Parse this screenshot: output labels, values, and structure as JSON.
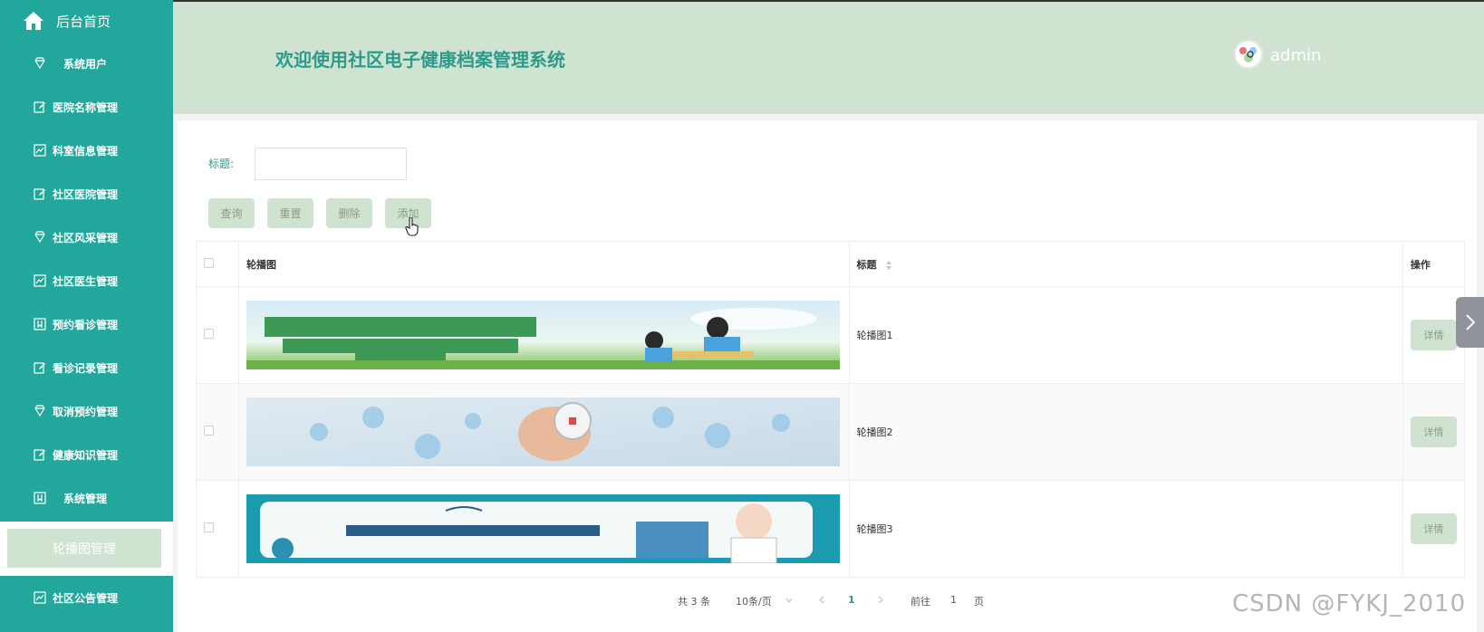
{
  "sidebar": {
    "home": {
      "label": "后台首页",
      "icon": "home-icon"
    },
    "items": [
      {
        "label": "系统用户",
        "icon": "diamond-icon"
      },
      {
        "label": "医院名称管理",
        "icon": "edit-icon"
      },
      {
        "label": "科室信息管理",
        "icon": "chart-icon"
      },
      {
        "label": "社区医院管理",
        "icon": "edit-icon"
      },
      {
        "label": "社区风采管理",
        "icon": "diamond-icon"
      },
      {
        "label": "社区医生管理",
        "icon": "chart-icon"
      },
      {
        "label": "预约看诊管理",
        "icon": "bookmark-icon"
      },
      {
        "label": "看诊记录管理",
        "icon": "edit-icon"
      },
      {
        "label": "取消预约管理",
        "icon": "diamond-icon"
      },
      {
        "label": "健康知识管理",
        "icon": "edit-icon"
      },
      {
        "label": "系统管理",
        "icon": "bookmark-icon"
      }
    ],
    "submenu_active": "轮播图管理",
    "last_item": {
      "label": "社区公告管理",
      "icon": "chart-icon"
    }
  },
  "header": {
    "title": "欢迎使用社区电子健康档案管理系统",
    "username": "admin"
  },
  "search": {
    "label": "标题:",
    "value": ""
  },
  "buttons": {
    "query": "查询",
    "reset": "重置",
    "delete": "删除",
    "add": "添加"
  },
  "table": {
    "headers": {
      "image": "轮播图",
      "title": "标题",
      "actions": "操作"
    },
    "rows": [
      {
        "title": "轮播图1",
        "action": "详情"
      },
      {
        "title": "轮播图2",
        "action": "详情"
      },
      {
        "title": "轮播图3",
        "action": "详情"
      }
    ]
  },
  "pagination": {
    "total": "共 3 条",
    "page_size": "10条/页",
    "current_page": "1",
    "goto_prefix": "前往",
    "goto_value": "1",
    "goto_suffix": "页"
  },
  "watermark": "CSDN @FYKJ_2010",
  "colors": {
    "sidebar": "#21a79b",
    "header": "#cfe3d0",
    "accent": "#2e9a8b"
  }
}
